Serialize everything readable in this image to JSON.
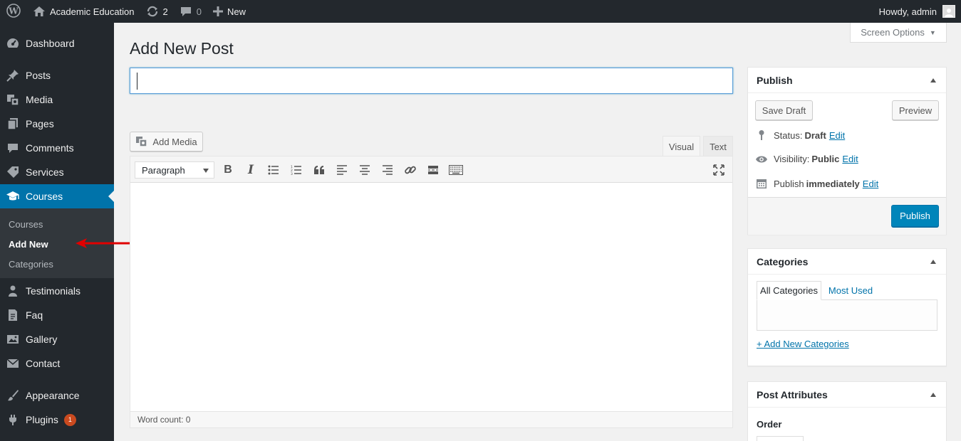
{
  "colors": {
    "adminbar_bg": "#23282d",
    "accent": "#0073aa",
    "publish_button": "#0085ba",
    "badge": "#ca4a1f",
    "annotation_arrow": "#e00000"
  },
  "adminbar": {
    "site_name": "Academic Education",
    "updates_count": "2",
    "comments_count": "0",
    "new_label": "New",
    "howdy": "Howdy, admin",
    "icons": [
      "wordpress-logo-icon",
      "home-icon",
      "updates-icon",
      "comment-icon",
      "plus-icon",
      "avatar-icon"
    ]
  },
  "sidebar": {
    "items": [
      {
        "label": "Dashboard",
        "icon": "dashboard-icon"
      },
      {
        "label": "Posts",
        "icon": "pin-icon"
      },
      {
        "label": "Media",
        "icon": "media-icon"
      },
      {
        "label": "Pages",
        "icon": "pages-icon"
      },
      {
        "label": "Comments",
        "icon": "comment-icon"
      },
      {
        "label": "Services",
        "icon": "tag-icon"
      },
      {
        "label": "Courses",
        "icon": "graduation-cap-icon",
        "current": true
      },
      {
        "label": "Testimonials",
        "icon": "users-icon"
      },
      {
        "label": "Faq",
        "icon": "document-icon"
      },
      {
        "label": "Gallery",
        "icon": "gallery-icon"
      },
      {
        "label": "Contact",
        "icon": "mail-icon"
      },
      {
        "label": "Appearance",
        "icon": "brush-icon"
      },
      {
        "label": "Plugins",
        "icon": "plugin-icon",
        "badge": "1"
      }
    ],
    "submenu": [
      {
        "label": "Courses"
      },
      {
        "label": "Add New",
        "active": true
      },
      {
        "label": "Categories"
      }
    ]
  },
  "screen_options": "Screen Options",
  "page_title": "Add New Post",
  "editor": {
    "add_media": "Add Media",
    "tab_visual": "Visual",
    "tab_text": "Text",
    "format_value": "Paragraph",
    "toolbar_icons": [
      "bold-icon",
      "italic-icon",
      "bullet-list-icon",
      "numbered-list-icon",
      "blockquote-icon",
      "align-left-icon",
      "align-center-icon",
      "align-right-icon",
      "link-icon",
      "read-more-icon",
      "toolbar-toggle-icon",
      "fullscreen-icon"
    ],
    "word_count": "Word count: 0"
  },
  "publish_box": {
    "title": "Publish",
    "save_draft": "Save Draft",
    "preview": "Preview",
    "status_label": "Status:",
    "status_value": "Draft",
    "visibility_label": "Visibility:",
    "visibility_value": "Public",
    "publish_label": "Publish",
    "publish_value": "immediately",
    "edit": "Edit",
    "publish_button": "Publish"
  },
  "categories_box": {
    "title": "Categories",
    "tab_all": "All Categories",
    "tab_most_used": "Most Used",
    "add_new": "+ Add New Categories"
  },
  "attributes_box": {
    "title": "Post Attributes",
    "order_label": "Order"
  }
}
